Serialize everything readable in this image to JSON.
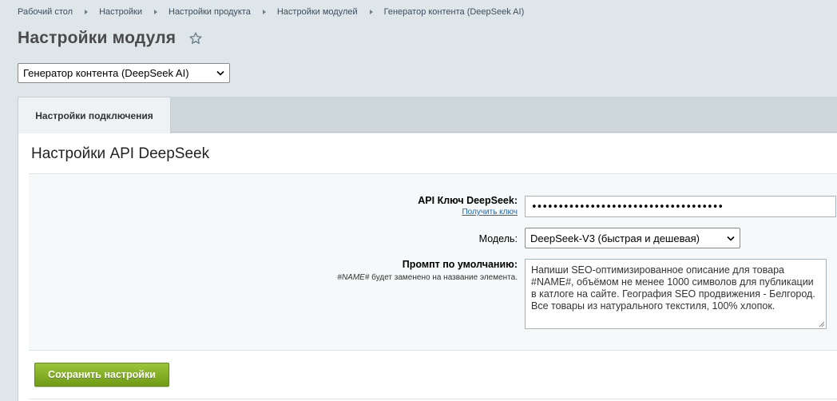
{
  "breadcrumb": [
    "Рабочий стол",
    "Настройки",
    "Настройки продукта",
    "Настройки модулей",
    "Генератор контента (DeepSeek AI)"
  ],
  "page_title": "Настройки модуля",
  "module_select": {
    "value": "Генератор контента (DeepSeek AI)"
  },
  "tabs": [
    {
      "label": "Настройки подключения",
      "active": true
    }
  ],
  "section_title": "Настройки API DeepSeek",
  "form": {
    "api_key": {
      "label": "API Ключ DeepSeek:",
      "link": "Получить ключ",
      "value": "••••••••••••••••••••••••••••••••••••"
    },
    "model": {
      "label": "Модель:",
      "value": "DeepSeek-V3 (быстрая и дешевая)"
    },
    "prompt": {
      "label": "Промпт по умолчанию:",
      "hint_code": "#NAME#",
      "hint_text": " будет заменено на название элемента.",
      "value": "Напиши SEO-оптимизированное описание для товара #NAME#, объёмом не менее 1000 символов для публикации в катлоге на сайте. География SEO продвижения - Белгород. Все товары из натурального текстиля, 100% хлопок."
    }
  },
  "save_button": "Сохранить настройки",
  "colors": {
    "accent_green": "#7aa81f",
    "link": "#2067b0"
  },
  "icons": [
    "star-icon",
    "chevron-down-icon",
    "resize-grip-icon"
  ]
}
